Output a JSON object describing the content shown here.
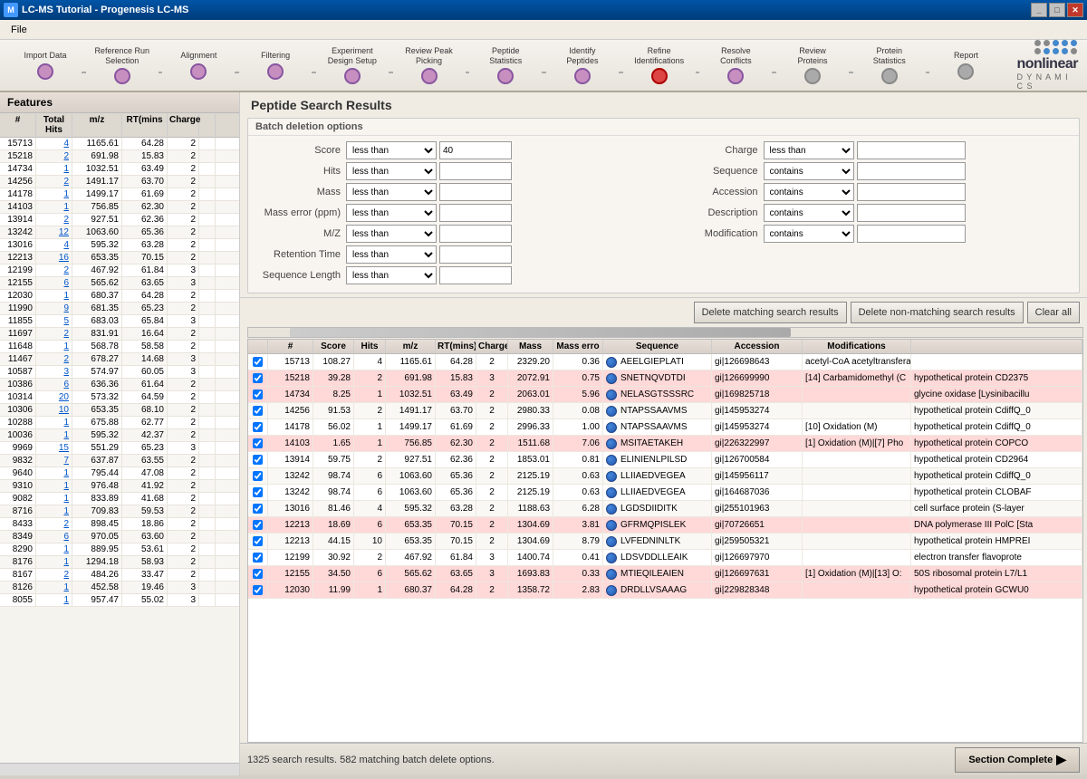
{
  "titleBar": {
    "title": "LC-MS Tutorial - Progenesis LC-MS",
    "buttons": [
      "_",
      "□",
      "✕"
    ]
  },
  "menuBar": {
    "items": [
      "File"
    ]
  },
  "workflow": {
    "items": [
      {
        "label": "Import Data",
        "state": "done"
      },
      {
        "label": "Reference Run Selection",
        "state": "done"
      },
      {
        "label": "Alignment",
        "state": "done"
      },
      {
        "label": "Filtering",
        "state": "done"
      },
      {
        "label": "Experiment Design Setup",
        "state": "done"
      },
      {
        "label": "Review Peak Picking",
        "state": "done"
      },
      {
        "label": "Peptide Statistics",
        "state": "done"
      },
      {
        "label": "Identify Peptides",
        "state": "done"
      },
      {
        "label": "Refine Identifications",
        "state": "active"
      },
      {
        "label": "Resolve Conflicts",
        "state": "done"
      },
      {
        "label": "Review Proteins",
        "state": "pending"
      },
      {
        "label": "Protein Statistics",
        "state": "pending"
      },
      {
        "label": "Report",
        "state": "pending"
      }
    ]
  },
  "leftPanel": {
    "title": "Features",
    "columns": [
      "#",
      "Total Hits",
      "m/z",
      "RT(mins",
      "Charge",
      ""
    ],
    "rows": [
      {
        "num": "15713",
        "hits": "4",
        "mz": "1165.61",
        "rt": "64.28",
        "charge": "2",
        "sel": false
      },
      {
        "num": "15218",
        "hits": "2",
        "mz": "691.98",
        "rt": "15.83",
        "charge": "2",
        "sel": false
      },
      {
        "num": "14734",
        "hits": "1",
        "mz": "1032.51",
        "rt": "63.49",
        "charge": "2",
        "sel": false
      },
      {
        "num": "14256",
        "hits": "2",
        "mz": "1491.17",
        "rt": "63.70",
        "charge": "2",
        "sel": false
      },
      {
        "num": "14178",
        "hits": "1",
        "mz": "1499.17",
        "rt": "61.69",
        "charge": "2",
        "sel": false
      },
      {
        "num": "14103",
        "hits": "1",
        "mz": "756.85",
        "rt": "62.30",
        "charge": "2",
        "sel": false
      },
      {
        "num": "13914",
        "hits": "2",
        "mz": "927.51",
        "rt": "62.36",
        "charge": "2",
        "sel": false
      },
      {
        "num": "13242",
        "hits": "12",
        "mz": "1063.60",
        "rt": "65.36",
        "charge": "2",
        "sel": false
      },
      {
        "num": "13016",
        "hits": "4",
        "mz": "595.32",
        "rt": "63.28",
        "charge": "2",
        "sel": false
      },
      {
        "num": "12213",
        "hits": "16",
        "mz": "653.35",
        "rt": "70.15",
        "charge": "2",
        "sel": false
      },
      {
        "num": "12199",
        "hits": "2",
        "mz": "467.92",
        "rt": "61.84",
        "charge": "3",
        "sel": false
      },
      {
        "num": "12155",
        "hits": "6",
        "mz": "565.62",
        "rt": "63.65",
        "charge": "3",
        "sel": false
      },
      {
        "num": "12030",
        "hits": "1",
        "mz": "680.37",
        "rt": "64.28",
        "charge": "2",
        "sel": false
      },
      {
        "num": "11990",
        "hits": "9",
        "mz": "681.35",
        "rt": "65.23",
        "charge": "2",
        "sel": false
      },
      {
        "num": "11855",
        "hits": "5",
        "mz": "683.03",
        "rt": "65.84",
        "charge": "3",
        "sel": false
      },
      {
        "num": "11697",
        "hits": "2",
        "mz": "831.91",
        "rt": "16.64",
        "charge": "2",
        "sel": false
      },
      {
        "num": "11648",
        "hits": "1",
        "mz": "568.78",
        "rt": "58.58",
        "charge": "2",
        "sel": false
      },
      {
        "num": "11467",
        "hits": "2",
        "mz": "678.27",
        "rt": "14.68",
        "charge": "3",
        "sel": false
      },
      {
        "num": "10587",
        "hits": "3",
        "mz": "574.97",
        "rt": "60.05",
        "charge": "3",
        "sel": false
      },
      {
        "num": "10386",
        "hits": "6",
        "mz": "636.36",
        "rt": "61.64",
        "charge": "2",
        "sel": false
      },
      {
        "num": "10314",
        "hits": "20",
        "mz": "573.32",
        "rt": "64.59",
        "charge": "2",
        "sel": false
      },
      {
        "num": "10306",
        "hits": "10",
        "mz": "653.35",
        "rt": "68.10",
        "charge": "2",
        "sel": false
      },
      {
        "num": "10288",
        "hits": "1",
        "mz": "675.88",
        "rt": "62.77",
        "charge": "2",
        "sel": false
      },
      {
        "num": "10036",
        "hits": "1",
        "mz": "595.32",
        "rt": "42.37",
        "charge": "2",
        "sel": false
      },
      {
        "num": "9969",
        "hits": "15",
        "mz": "551.29",
        "rt": "65.23",
        "charge": "3",
        "sel": false
      },
      {
        "num": "9832",
        "hits": "7",
        "mz": "637.87",
        "rt": "63.55",
        "charge": "2",
        "sel": false
      },
      {
        "num": "9640",
        "hits": "1",
        "mz": "795.44",
        "rt": "47.08",
        "charge": "2",
        "sel": false
      },
      {
        "num": "9310",
        "hits": "1",
        "mz": "976.48",
        "rt": "41.92",
        "charge": "2",
        "sel": false
      },
      {
        "num": "9082",
        "hits": "1",
        "mz": "833.89",
        "rt": "41.68",
        "charge": "2",
        "sel": false
      },
      {
        "num": "8716",
        "hits": "1",
        "mz": "709.83",
        "rt": "59.53",
        "charge": "2",
        "sel": false
      },
      {
        "num": "8433",
        "hits": "2",
        "mz": "898.45",
        "rt": "18.86",
        "charge": "2",
        "sel": false
      },
      {
        "num": "8349",
        "hits": "6",
        "mz": "970.05",
        "rt": "63.60",
        "charge": "2",
        "sel": false
      },
      {
        "num": "8290",
        "hits": "1",
        "mz": "889.95",
        "rt": "53.61",
        "charge": "2",
        "sel": false
      },
      {
        "num": "8176",
        "hits": "1",
        "mz": "1294.18",
        "rt": "58.93",
        "charge": "2",
        "sel": false
      },
      {
        "num": "8167",
        "hits": "2",
        "mz": "484.26",
        "rt": "33.47",
        "charge": "2",
        "sel": false
      },
      {
        "num": "8126",
        "hits": "1",
        "mz": "452.58",
        "rt": "19.46",
        "charge": "3",
        "sel": false
      },
      {
        "num": "8055",
        "hits": "1",
        "mz": "957.47",
        "rt": "55.02",
        "charge": "3",
        "sel": false
      }
    ]
  },
  "mainPanel": {
    "title": "Peptide Search Results",
    "batchSection": {
      "header": "Batch deletion options",
      "leftFilters": [
        {
          "label": "Score",
          "operator": "less than",
          "value": "40"
        },
        {
          "label": "Hits",
          "operator": "less than",
          "value": ""
        },
        {
          "label": "Mass",
          "operator": "less than",
          "value": ""
        },
        {
          "label": "Mass error (ppm)",
          "operator": "less than",
          "value": ""
        },
        {
          "label": "M/Z",
          "operator": "less than",
          "value": ""
        },
        {
          "label": "Retention Time",
          "operator": "less than",
          "value": ""
        },
        {
          "label": "Sequence Length",
          "operator": "less than",
          "value": ""
        }
      ],
      "rightFilters": [
        {
          "label": "Charge",
          "operator": "less than",
          "value": ""
        },
        {
          "label": "Sequence",
          "operator": "contains",
          "value": ""
        },
        {
          "label": "Accession",
          "operator": "contains",
          "value": ""
        },
        {
          "label": "Description",
          "operator": "contains",
          "value": ""
        },
        {
          "label": "Modification",
          "operator": "contains",
          "value": ""
        }
      ]
    },
    "actionButtons": {
      "delete": "Delete matching search results",
      "deleteNon": "Delete non-matching search results",
      "clear": "Clear all"
    },
    "resultsTable": {
      "columns": [
        "",
        "#",
        "Score",
        "Hits",
        "m/z",
        "RT(mins)",
        "Charge",
        "Mass",
        "Mass erro",
        "Sequence",
        "Accession",
        "Modifications",
        "Description"
      ],
      "rows": [
        {
          "checked": true,
          "num": "15713",
          "score": "108.27",
          "hits": "4",
          "mz": "1165.61",
          "rt": "64.28",
          "charge": "2",
          "mass": "2329.20",
          "masserr": "0.36",
          "sequence": "AEELGIEPLATI",
          "accession": "gi|126698643",
          "modifications": "acetyl-CoA acetyltransfera",
          "highlighted": false
        },
        {
          "checked": true,
          "num": "15218",
          "score": "39.28",
          "hits": "2",
          "mz": "691.98",
          "rt": "15.83",
          "charge": "3",
          "mass": "2072.91",
          "masserr": "0.75",
          "sequence": "SNETNQVDTDI",
          "accession": "gi|126699990",
          "modifications": "[14] Carbamidomethyl (C",
          "description": "hypothetical protein CD2375",
          "highlighted": true
        },
        {
          "checked": true,
          "num": "14734",
          "score": "8.25",
          "hits": "1",
          "mz": "1032.51",
          "rt": "63.49",
          "charge": "2",
          "mass": "2063.01",
          "masserr": "5.96",
          "sequence": "NELASGTSSSRC",
          "accession": "gi|169825718",
          "modifications": "",
          "description": "glycine oxidase [Lysinibacillu",
          "highlighted": true
        },
        {
          "checked": true,
          "num": "14256",
          "score": "91.53",
          "hits": "2",
          "mz": "1491.17",
          "rt": "63.70",
          "charge": "2",
          "mass": "2980.33",
          "masserr": "0.08",
          "sequence": "NTAPSSAAVMS",
          "accession": "gi|145953274",
          "modifications": "",
          "description": "hypothetical protein CdiffQ_0",
          "highlighted": false
        },
        {
          "checked": true,
          "num": "14178",
          "score": "56.02",
          "hits": "1",
          "mz": "1499.17",
          "rt": "61.69",
          "charge": "2",
          "mass": "2996.33",
          "masserr": "1.00",
          "sequence": "NTAPSSAAVMS",
          "accession": "gi|145953274",
          "modifications": "[10] Oxidation (M)",
          "description": "hypothetical protein CdiffQ_0",
          "highlighted": false
        },
        {
          "checked": true,
          "num": "14103",
          "score": "1.65",
          "hits": "1",
          "mz": "756.85",
          "rt": "62.30",
          "charge": "2",
          "mass": "1511.68",
          "masserr": "7.06",
          "sequence": "MSITAETAKEH",
          "accession": "gi|226322997",
          "modifications": "[1] Oxidation (M)|[7] Pho",
          "description": "hypothetical protein COPCO",
          "highlighted": true
        },
        {
          "checked": true,
          "num": "13914",
          "score": "59.75",
          "hits": "2",
          "mz": "927.51",
          "rt": "62.36",
          "charge": "2",
          "mass": "1853.01",
          "masserr": "0.81",
          "sequence": "ELINIENLPILSD",
          "accession": "gi|126700584",
          "modifications": "",
          "description": "hypothetical protein CD2964",
          "highlighted": false
        },
        {
          "checked": true,
          "num": "13242",
          "score": "98.74",
          "hits": "6",
          "mz": "1063.60",
          "rt": "65.36",
          "charge": "2",
          "mass": "2125.19",
          "masserr": "0.63",
          "sequence": "LLIIAEDVEGEA",
          "accession": "gi|145956117",
          "modifications": "",
          "description": "hypothetical protein CdiffQ_0",
          "highlighted": false
        },
        {
          "checked": true,
          "num": "13242",
          "score": "98.74",
          "hits": "6",
          "mz": "1063.60",
          "rt": "65.36",
          "charge": "2",
          "mass": "2125.19",
          "masserr": "0.63",
          "sequence": "LLIIAEDVEGEA",
          "accession": "gi|164687036",
          "modifications": "",
          "description": "hypothetical protein CLOBAF",
          "highlighted": false
        },
        {
          "checked": true,
          "num": "13016",
          "score": "81.46",
          "hits": "4",
          "mz": "595.32",
          "rt": "63.28",
          "charge": "2",
          "mass": "1188.63",
          "masserr": "6.28",
          "sequence": "LGDSDIIDITK",
          "accession": "gi|255101963",
          "modifications": "",
          "description": "cell surface protein (S-layer",
          "highlighted": false
        },
        {
          "checked": true,
          "num": "12213",
          "score": "18.69",
          "hits": "6",
          "mz": "653.35",
          "rt": "70.15",
          "charge": "2",
          "mass": "1304.69",
          "masserr": "3.81",
          "sequence": "GFRMQPISLEK",
          "accession": "gi|70726651",
          "modifications": "",
          "description": "DNA polymerase III PolC [Sta",
          "highlighted": true
        },
        {
          "checked": true,
          "num": "12213",
          "score": "44.15",
          "hits": "10",
          "mz": "653.35",
          "rt": "70.15",
          "charge": "2",
          "mass": "1304.69",
          "masserr": "8.79",
          "sequence": "LVFEDNINLTK",
          "accession": "gi|259505321",
          "modifications": "",
          "description": "hypothetical protein HMPREI",
          "highlighted": false
        },
        {
          "checked": true,
          "num": "12199",
          "score": "30.92",
          "hits": "2",
          "mz": "467.92",
          "rt": "61.84",
          "charge": "3",
          "mass": "1400.74",
          "masserr": "0.41",
          "sequence": "LDSVDDLLEAIK",
          "accession": "gi|126697970",
          "modifications": "",
          "description": "electron transfer flavoprote",
          "highlighted": false
        },
        {
          "checked": true,
          "num": "12155",
          "score": "34.50",
          "hits": "6",
          "mz": "565.62",
          "rt": "63.65",
          "charge": "3",
          "mass": "1693.83",
          "masserr": "0.33",
          "sequence": "MTIEQILEAIEN",
          "accession": "gi|126697631",
          "modifications": "[1] Oxidation (M)|[13] O:",
          "description": "50S ribosomal protein L7/L1",
          "highlighted": true
        },
        {
          "checked": true,
          "num": "12030",
          "score": "11.99",
          "hits": "1",
          "mz": "680.37",
          "rt": "64.28",
          "charge": "2",
          "mass": "1358.72",
          "masserr": "2.83",
          "sequence": "DRDLLVSAAAG",
          "accession": "gi|229828348",
          "modifications": "",
          "description": "hypothetical protein GCWU0",
          "highlighted": true
        }
      ]
    },
    "statusText": "1325 search results. 582 matching batch delete options.",
    "sectionComplete": "Section Complete"
  }
}
